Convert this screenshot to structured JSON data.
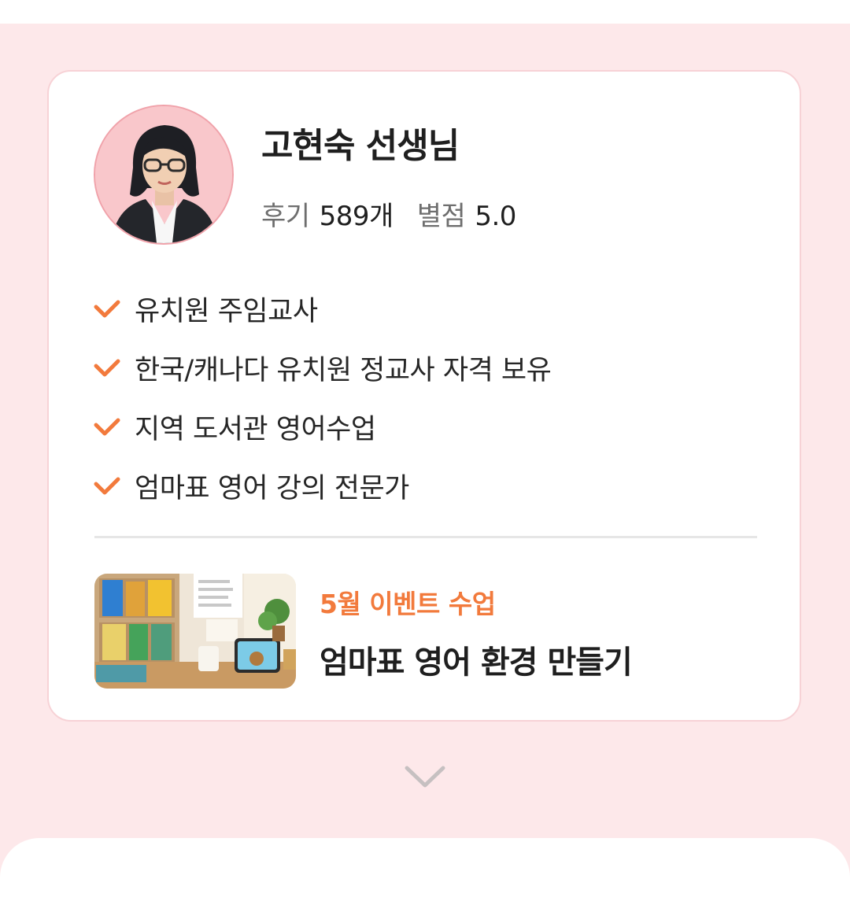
{
  "teacher": {
    "name": "고현숙 선생님",
    "review_label": "후기",
    "review_count": "589개",
    "rating_label": "별점",
    "rating_value": "5.0"
  },
  "credentials": [
    "유치원 주임교사",
    "한국/캐나다 유치원 정교사 자격 보유",
    "지역 도서관 영어수업",
    "엄마표 영어 강의 전문가"
  ],
  "event": {
    "tag": "5월 이벤트 수업",
    "title": "엄마표 영어 환경 만들기"
  },
  "icons": {
    "check": "check-icon",
    "expand": "chevron-down-icon"
  },
  "colors": {
    "background": "#fde8ea",
    "accent": "#f27a3c",
    "card_border": "#f7d2d6",
    "avatar_bg": "#f9c7cb"
  }
}
